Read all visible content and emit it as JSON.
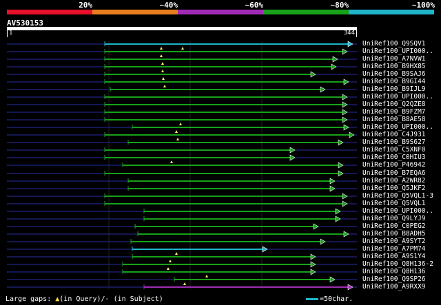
{
  "identity_scale": {
    "colors": [
      "#e8102a",
      "#e87d1e",
      "#a02cb5",
      "#17a21a",
      "#1fb5c9"
    ],
    "labels": [
      "20%",
      "~40%",
      "~60%",
      "~80%",
      "~100%"
    ]
  },
  "query": {
    "name": "AV530153",
    "start": "1",
    "end": "344"
  },
  "bar_colors": {
    "cyan": "#1fb5c9",
    "green": "#17a21a",
    "purple": "#a02cb5"
  },
  "hits": [
    {
      "label": "UniRef100_Q9SQV1",
      "color": "cyan"
    },
    {
      "label": "UniRef100_UPI000..",
      "color": "green"
    },
    {
      "label": "UniRef100_A7NVW1",
      "color": "green"
    },
    {
      "label": "UniRef100_B9HX85",
      "color": "green"
    },
    {
      "label": "UniRef100_B9SAJ6",
      "color": "green"
    },
    {
      "label": "UniRef100_B9GI44",
      "color": "green"
    },
    {
      "label": "UniRef100_B9IJL9",
      "color": "green"
    },
    {
      "label": "UniRef100_UPI000..",
      "color": "green"
    },
    {
      "label": "UniRef100_Q2QZE8",
      "color": "green"
    },
    {
      "label": "UniRef100_B9FZM7",
      "color": "green"
    },
    {
      "label": "UniRef100_B8AE58",
      "color": "green"
    },
    {
      "label": "UniRef100_UPI000..",
      "color": "green"
    },
    {
      "label": "UniRef100_C4J931",
      "color": "green"
    },
    {
      "label": "UniRef100_B9S627",
      "color": "green"
    },
    {
      "label": "UniRef100_C5XNF0",
      "color": "green"
    },
    {
      "label": "UniRef100_C0HIU3",
      "color": "green"
    },
    {
      "label": "UniRef100_P46942",
      "color": "green"
    },
    {
      "label": "UniRef100_B7EQA6",
      "color": "green"
    },
    {
      "label": "UniRef100_A2WR82",
      "color": "green"
    },
    {
      "label": "UniRef100_Q5JKF2",
      "color": "green"
    },
    {
      "label": "UniRef100_Q5VQL1-3",
      "color": "green"
    },
    {
      "label": "UniRef100_Q5VQL1",
      "color": "green"
    },
    {
      "label": "UniRef100_UPI000..",
      "color": "green"
    },
    {
      "label": "UniRef100_Q9LYJ9",
      "color": "green"
    },
    {
      "label": "UniRef100_C0PEG2",
      "color": "green"
    },
    {
      "label": "UniRef100_B8ADH5",
      "color": "green"
    },
    {
      "label": "UniRef100_A9SYT2",
      "color": "green"
    },
    {
      "label": "UniRef100_A7PM74",
      "color": "cyan"
    },
    {
      "label": "UniRef100_A9S1Y4",
      "color": "green"
    },
    {
      "label": "UniRef100_Q8H136-2",
      "color": "green"
    },
    {
      "label": "UniRef100_Q8H136",
      "color": "green"
    },
    {
      "label": "UniRef100_Q9SP26",
      "color": "green"
    },
    {
      "label": "UniRef100_A9RXX9",
      "color": "purple"
    }
  ],
  "footer": {
    "gaps_prefix": "Large gaps: ",
    "gaps_query": "(in Query)/",
    "gaps_dash": "-",
    "gaps_subject": " (in Subject)",
    "scale_label": "=50char."
  }
}
